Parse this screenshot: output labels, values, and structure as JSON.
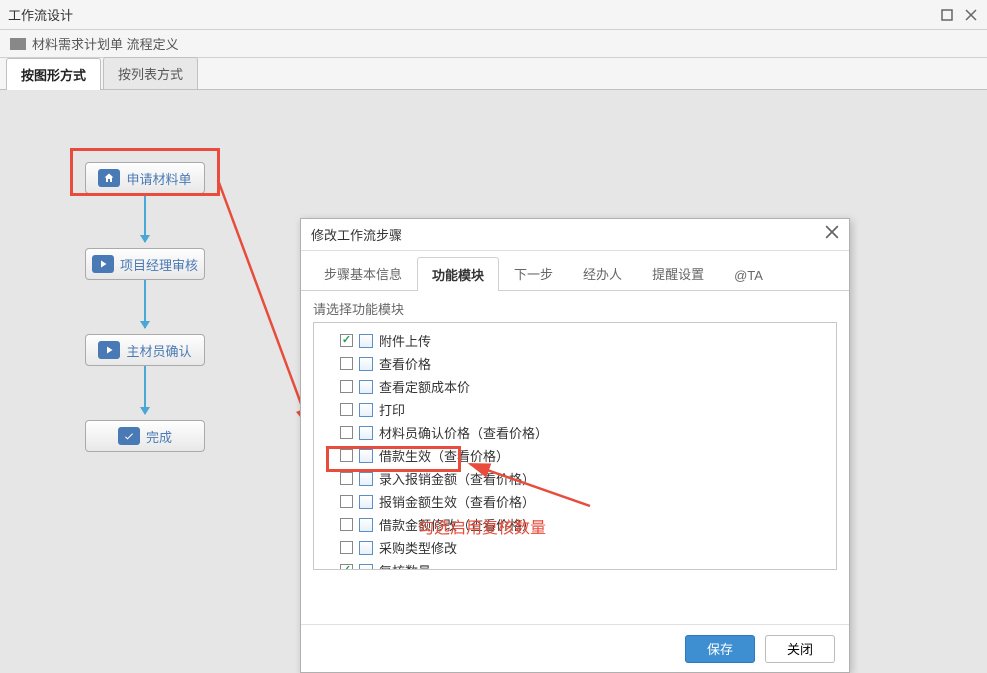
{
  "window": {
    "title": "工作流设计",
    "subtitle": "材料需求计划单 流程定义"
  },
  "main_tabs": {
    "items": [
      {
        "label": "按图形方式",
        "active": true
      },
      {
        "label": "按列表方式",
        "active": false
      }
    ]
  },
  "flow_nodes": [
    {
      "label": "申请材料单",
      "icon": "home"
    },
    {
      "label": "项目经理审核",
      "icon": "play"
    },
    {
      "label": "主材员确认",
      "icon": "play"
    },
    {
      "label": "完成",
      "icon": "check"
    }
  ],
  "dialog": {
    "title": "修改工作流步骤",
    "tabs": [
      {
        "label": "步骤基本信息",
        "active": false
      },
      {
        "label": "功能模块",
        "active": true
      },
      {
        "label": "下一步",
        "active": false
      },
      {
        "label": "经办人",
        "active": false
      },
      {
        "label": "提醒设置",
        "active": false
      },
      {
        "label": "@TA",
        "active": false
      }
    ],
    "prompt": "请选择功能模块",
    "tree_items": [
      {
        "label": "附件上传",
        "checked": true
      },
      {
        "label": "查看价格",
        "checked": false
      },
      {
        "label": "查看定额成本价",
        "checked": false
      },
      {
        "label": "打印",
        "checked": false
      },
      {
        "label": "材料员确认价格（查看价格）",
        "checked": false
      },
      {
        "label": "借款生效（查看价格）",
        "checked": false
      },
      {
        "label": "录入报销金额（查看价格）",
        "checked": false
      },
      {
        "label": "报销金额生效（查看价格）",
        "checked": false
      },
      {
        "label": "借款金额修改（查看价格）",
        "checked": false
      },
      {
        "label": "采购类型修改",
        "checked": false
      },
      {
        "label": "复核数量",
        "checked": true
      }
    ],
    "buttons": {
      "save": "保存",
      "close": "关闭"
    }
  },
  "annotation": {
    "text": "勾选启用复核数量"
  }
}
